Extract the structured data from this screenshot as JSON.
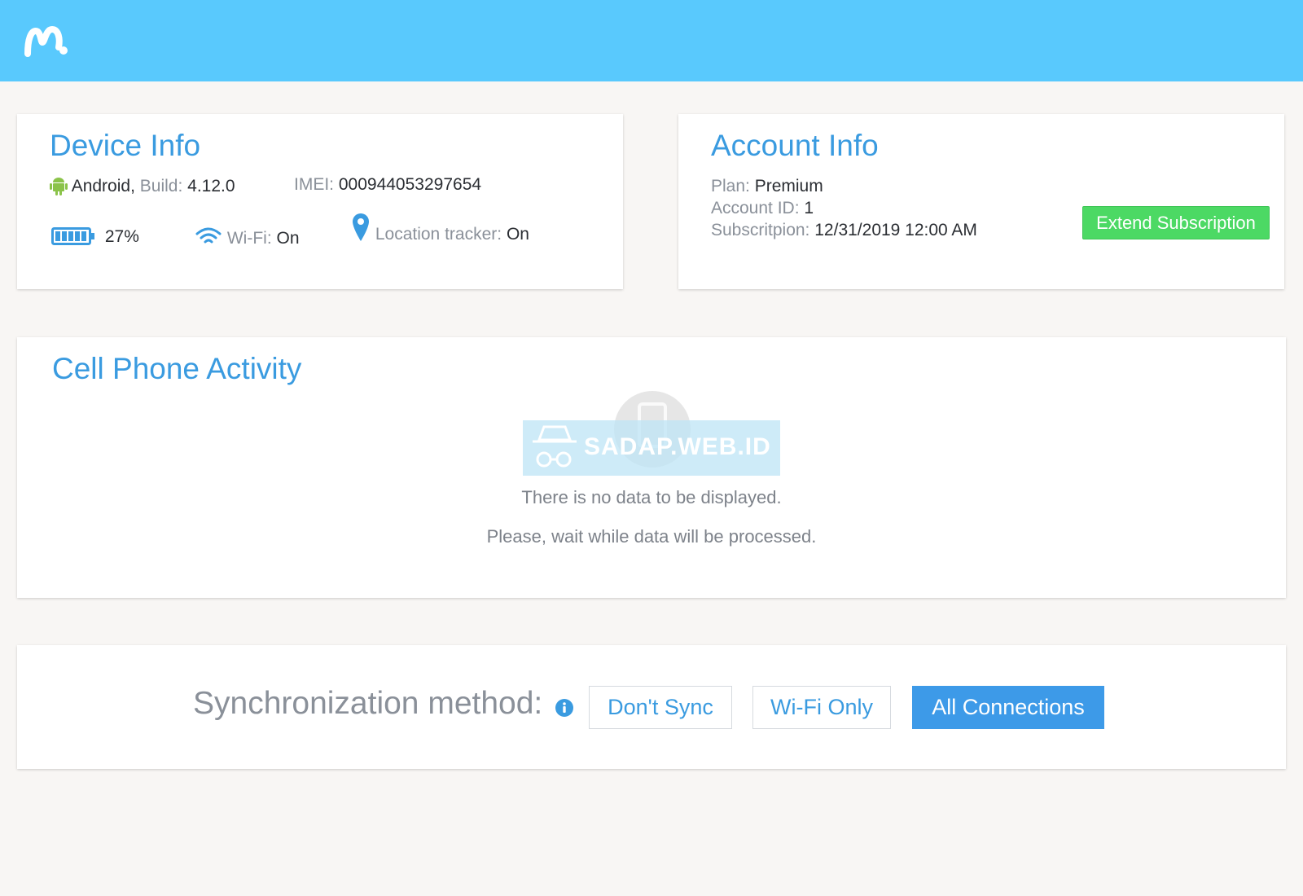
{
  "brand": {
    "logo_icon": "mspy-m-logo",
    "header_color": "#59c9fd"
  },
  "device_info": {
    "title": "Device Info",
    "os": "Android",
    "build_label": "Build:",
    "build_value": "4.12.0",
    "imei_label": "IMEI:",
    "imei_value": "000944053297654",
    "battery_percent": "27%",
    "battery_level": 0.27,
    "wifi_label": "Wi-Fi:",
    "wifi_value": "On",
    "location_label": "Location tracker:",
    "location_value": "On"
  },
  "account_info": {
    "title": "Account Info",
    "plan_label": "Plan:",
    "plan_value": "Premium",
    "account_id_label": "Account ID:",
    "account_id_value": "1",
    "subscription_label": "Subscritpion:",
    "subscription_value": "12/31/2019 12:00 AM",
    "extend_button": "Extend Subscription",
    "extend_color": "#4cd964"
  },
  "activity": {
    "title": "Cell Phone Activity",
    "watermark": "SADAP.WEB.ID",
    "empty_message": "There is no data to be displayed.",
    "wait_message": "Please, wait while data will be processed."
  },
  "sync": {
    "label": "Synchronization method:",
    "options": [
      "Don't Sync",
      "Wi-Fi Only",
      "All Connections"
    ],
    "selected": "All Connections",
    "accent_color": "#3d9ae8"
  }
}
